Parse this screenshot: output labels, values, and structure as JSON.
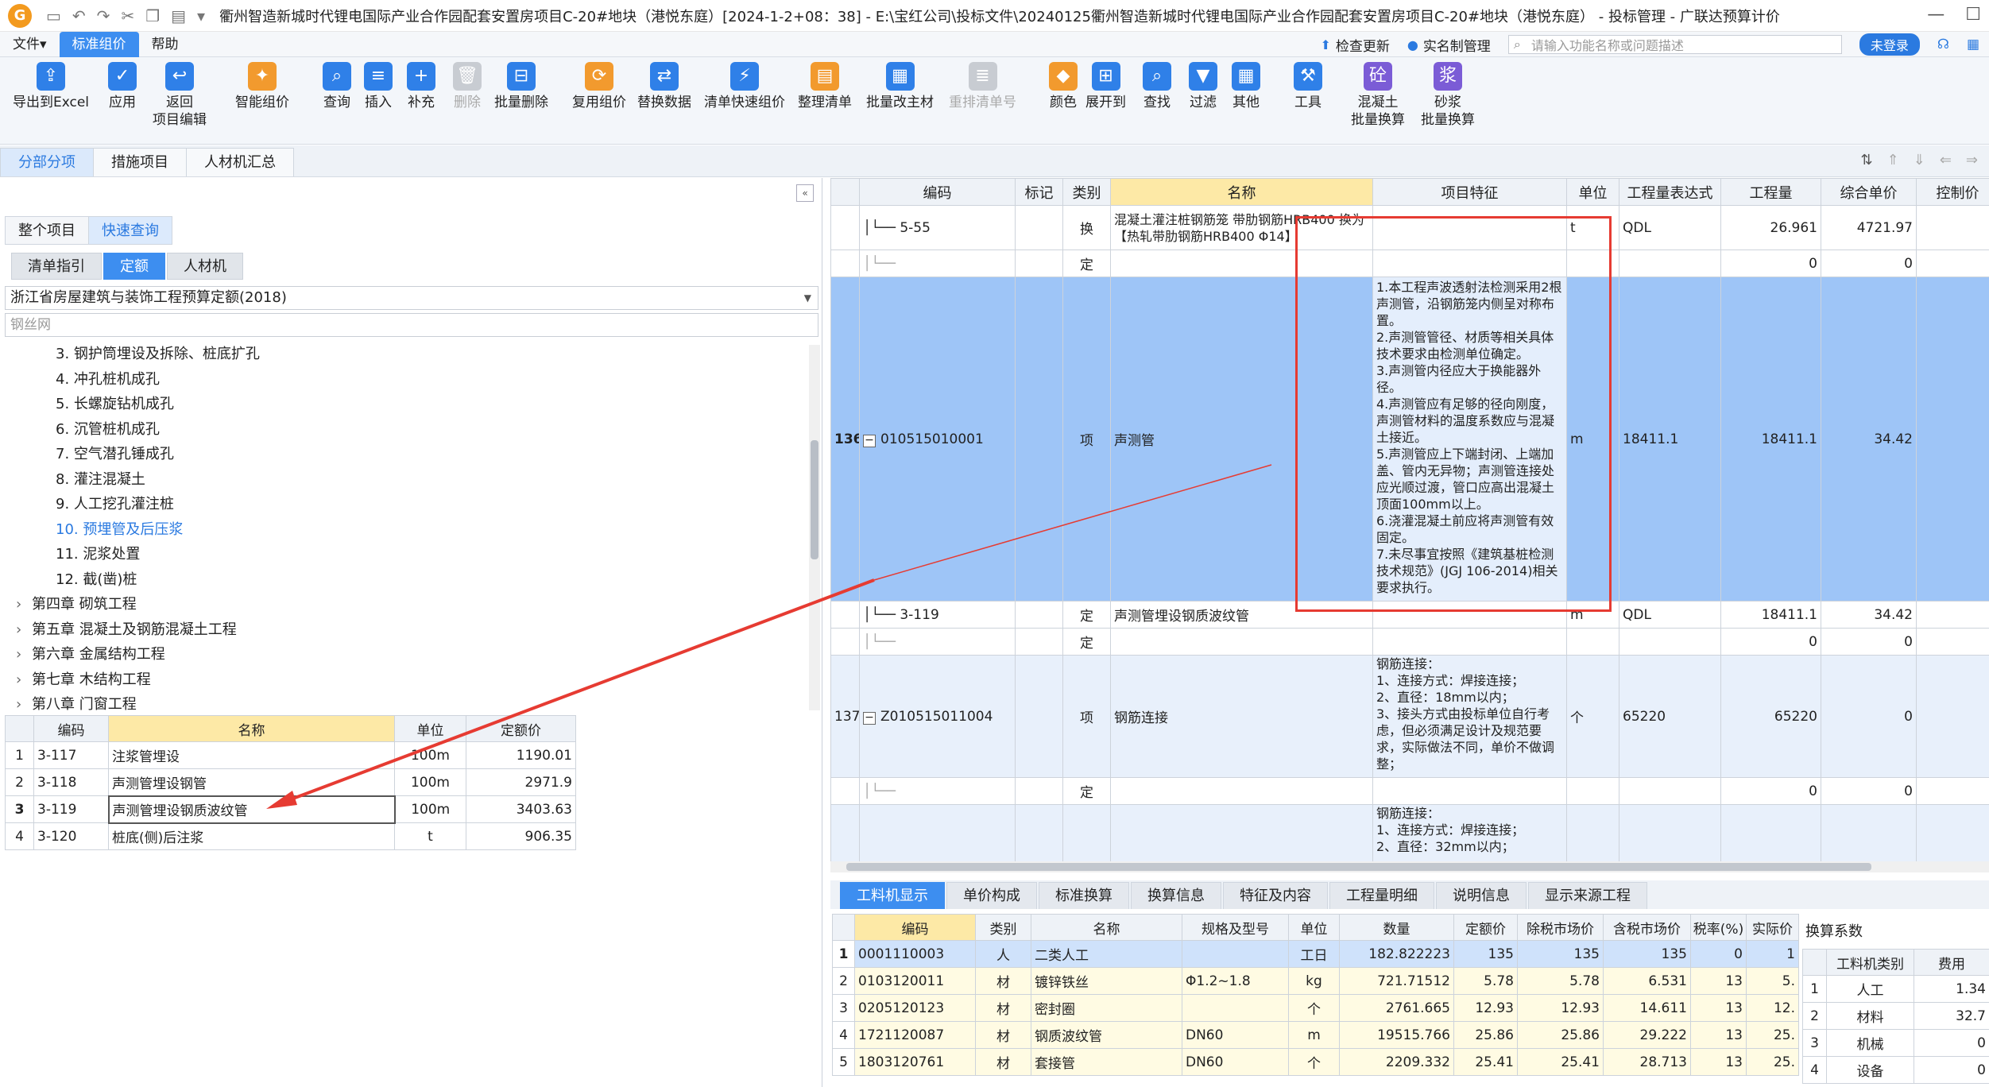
{
  "window": {
    "title": "衢州智造新城时代锂电国际产业合作园配套安置房项目C-20#地块（港悦东庭）[2024-1-2+08：38] - E:\\宝红公司\\投标文件\\20240125衢州智造新城时代锂电国际产业合作园配套安置房项目C-20#地块（港悦东庭） - 投标管理 - 广联达预算计价"
  },
  "menubar": {
    "items": [
      "文件▾",
      "标准组价",
      "帮助"
    ],
    "check_update": "检查更新",
    "realname": "实名制管理",
    "search_placeholder": "请输入功能名称或问题描述",
    "login": "未登录"
  },
  "ribbon": {
    "export_excel": "导出到Excel",
    "apply": "应用",
    "back_edit_1": "返回",
    "back_edit_2": "项目编辑",
    "smart_price": "智能组价",
    "query": "查询",
    "insert": "插入",
    "supplement": "补充",
    "delete": "删除",
    "batch_delete": "批量删除",
    "reuse_price": "复用组价",
    "replace_data": "替换数据",
    "quick_price": "清单快速组价",
    "sort_list": "整理清单",
    "batch_main": "批量改主材",
    "renumber": "重排清单号",
    "color": "颜色",
    "expand": "展开到",
    "find": "查找",
    "filter": "过滤",
    "other": "其他",
    "tools": "工具",
    "concrete_1": "混凝土",
    "concrete_2": "批量换算",
    "mortar_1": "砂浆",
    "mortar_2": "批量换算"
  },
  "main_tabs": [
    "分部分项",
    "措施项目",
    "人材机汇总"
  ],
  "left": {
    "subtabs": [
      "整个项目",
      "快速查询"
    ],
    "pills": [
      "清单指引",
      "定额",
      "人材机"
    ],
    "quota_lib": "浙江省房屋建筑与装饰工程预算定额(2018)",
    "filter_text": "钢丝网",
    "tree": [
      {
        "text": "3. 钢护筒埋设及拆除、桩底扩孔",
        "kind": "sub"
      },
      {
        "text": "4. 冲孔桩机成孔",
        "kind": "sub"
      },
      {
        "text": "5. 长螺旋钻机成孔",
        "kind": "sub"
      },
      {
        "text": "6. 沉管桩机成孔",
        "kind": "sub"
      },
      {
        "text": "7. 空气潜孔锤成孔",
        "kind": "sub"
      },
      {
        "text": "8. 灌注混凝土",
        "kind": "sub"
      },
      {
        "text": "9. 人工挖孔灌注桩",
        "kind": "sub"
      },
      {
        "text": "10. 预埋管及后压浆",
        "kind": "sub",
        "selected": true
      },
      {
        "text": "11. 泥浆处置",
        "kind": "sub"
      },
      {
        "text": "12. 截(凿)桩",
        "kind": "sub"
      },
      {
        "text": "第四章 砌筑工程",
        "kind": "chap"
      },
      {
        "text": "第五章 混凝土及钢筋混凝土工程",
        "kind": "chap"
      },
      {
        "text": "第六章 金属结构工程",
        "kind": "chap"
      },
      {
        "text": "第七章 木结构工程",
        "kind": "chap"
      },
      {
        "text": "第八章 门窗工程",
        "kind": "chap"
      }
    ],
    "quota_headers": [
      "编码",
      "名称",
      "单位",
      "定额价"
    ],
    "quota_rows": [
      {
        "idx": "1",
        "code": "3-117",
        "name": "注浆管埋设",
        "unit": "100m",
        "price": "1190.01"
      },
      {
        "idx": "2",
        "code": "3-118",
        "name": "声测管埋设钢管",
        "unit": "100m",
        "price": "2971.9"
      },
      {
        "idx": "3",
        "code": "3-119",
        "name": "声测管埋设钢质波纹管",
        "unit": "100m",
        "price": "3403.63"
      },
      {
        "idx": "4",
        "code": "3-120",
        "name": "桩底(侧)后注浆",
        "unit": "t",
        "price": "906.35"
      }
    ]
  },
  "grid": {
    "headers": [
      "编码",
      "标记",
      "类别",
      "名称",
      "项目特征",
      "单位",
      "工程量表达式",
      "工程量",
      "综合单价",
      "控制价"
    ],
    "r1": {
      "code": "5-55",
      "type": "换",
      "name": "混凝土灌注桩钢筋笼 带肋钢筋HRB400 换为【热轧带肋钢筋HRB400 Φ14】",
      "unit": "t",
      "expr": "QDL",
      "qty": "26.961",
      "price": "4721.97"
    },
    "r2": {
      "type": "定",
      "qty": "0",
      "price": "0"
    },
    "r3": {
      "no": "136",
      "code": "010515010001",
      "type": "项",
      "name": "声测管",
      "unit": "m",
      "expr": "18411.1",
      "qty": "18411.1",
      "price": "34.42",
      "feature": "1.本工程声波透射法检测采用2根声测管，沿钢筋笼内侧呈对称布置。\n2.声测管管径、材质等相关具体技术要求由检测单位确定。\n3.声测管内径应大于换能器外径。\n4.声测管应有足够的径向刚度，声测管材料的温度系数应与混凝土接近。\n5.声测管应上下端封闭、上端加盖、管内无异物；声测管连接处应光顺过渡，管口应高出混凝土顶面100mm以上。\n6.浇灌混凝土前应将声测管有效固定。\n7.未尽事宜按照《建筑基桩检测技术规范》(JGJ 106-2014)相关要求执行。"
    },
    "r4": {
      "code": "3-119",
      "type": "定",
      "name": "声测管埋设钢质波纹管",
      "unit": "m",
      "expr": "QDL",
      "qty": "18411.1",
      "price": "34.42"
    },
    "r5": {
      "type": "定",
      "qty": "0",
      "price": "0"
    },
    "r6": {
      "no": "137",
      "code": "Z010515011004",
      "type": "项",
      "name": "钢筋连接",
      "unit": "个",
      "expr": "65220",
      "qty": "65220",
      "price": "0",
      "feature": "钢筋连接：\n1、连接方式：焊接连接；\n2、直径：18mm以内；\n3、接头方式由投标单位自行考虑，但必须满足设计及规范要求，实际做法不同，单价不做调整；"
    },
    "r7": {
      "type": "定",
      "qty": "0",
      "price": "0"
    },
    "r8": {
      "feature": "钢筋连接：\n1、连接方式：焊接连接；\n2、直径：32mm以内；"
    }
  },
  "bottom_tabs": [
    "工料机显示",
    "单价构成",
    "标准换算",
    "换算信息",
    "特征及内容",
    "工程量明细",
    "说明信息",
    "显示来源工程"
  ],
  "res": {
    "headers": [
      "编码",
      "类别",
      "名称",
      "规格及型号",
      "单位",
      "数量",
      "定额价",
      "除税市场价",
      "含税市场价",
      "税率(%)",
      "实际价"
    ],
    "rows": [
      {
        "idx": "1",
        "code": "0001110003",
        "cat": "人",
        "name": "二类人工",
        "spec": "",
        "unit": "工日",
        "qty": "182.822223",
        "quota": "135",
        "ex": "135",
        "inc": "135",
        "tax": "0",
        "act": "1"
      },
      {
        "idx": "2",
        "code": "0103120011",
        "cat": "材",
        "name": "镀锌铁丝",
        "spec": "Φ1.2~1.8",
        "unit": "kg",
        "qty": "721.71512",
        "quota": "5.78",
        "ex": "5.78",
        "inc": "6.531",
        "tax": "13",
        "act": "5."
      },
      {
        "idx": "3",
        "code": "0205120123",
        "cat": "材",
        "name": "密封圈",
        "spec": "",
        "unit": "个",
        "qty": "2761.665",
        "quota": "12.93",
        "ex": "12.93",
        "inc": "14.611",
        "tax": "13",
        "act": "12."
      },
      {
        "idx": "4",
        "code": "1721120087",
        "cat": "材",
        "name": "钢质波纹管",
        "spec": "DN60",
        "unit": "m",
        "qty": "19515.766",
        "quota": "25.86",
        "ex": "25.86",
        "inc": "29.222",
        "tax": "13",
        "act": "25."
      },
      {
        "idx": "5",
        "code": "1803120761",
        "cat": "材",
        "name": "套接管",
        "spec": "DN60",
        "unit": "个",
        "qty": "2209.332",
        "quota": "25.41",
        "ex": "25.41",
        "inc": "28.713",
        "tax": "13",
        "act": "25."
      }
    ]
  },
  "coef": {
    "title": "换算系数",
    "headers": [
      "工料机类别",
      "费用"
    ],
    "rows": [
      {
        "idx": "1",
        "cat": "人工",
        "val": "1.34"
      },
      {
        "idx": "2",
        "cat": "材料",
        "val": "32.7"
      },
      {
        "idx": "3",
        "cat": "机械",
        "val": "0"
      },
      {
        "idx": "4",
        "cat": "设备",
        "val": "0"
      }
    ]
  },
  "colors": {
    "accent": "#3d8ef0",
    "selected_row": "#9ec5f7",
    "annotation": "#e63b32",
    "header_highlight": "#fde9a6"
  }
}
